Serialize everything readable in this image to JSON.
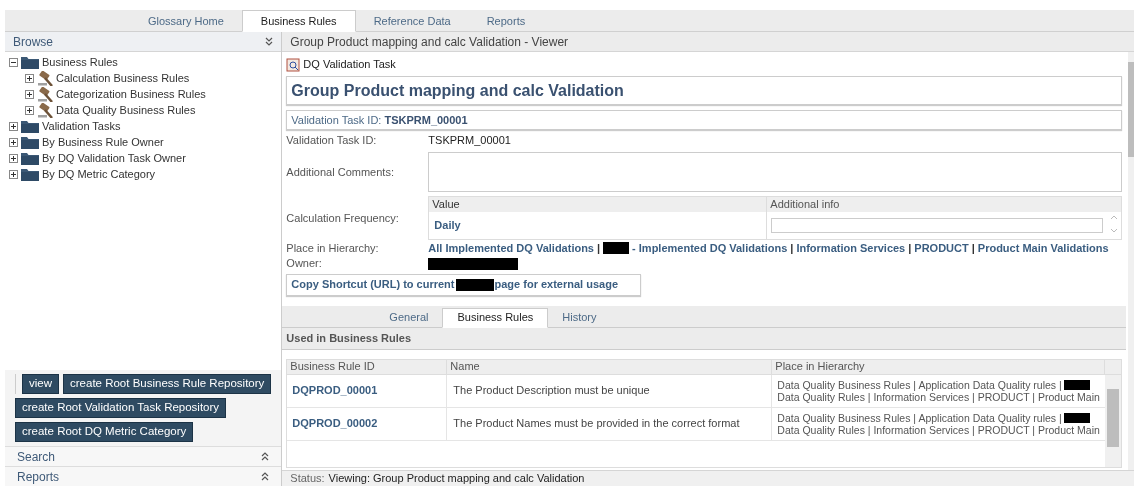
{
  "top_tabs": [
    {
      "label": "Glossary Home",
      "selected": false
    },
    {
      "label": "Business Rules",
      "selected": true
    },
    {
      "label": "Reference Data",
      "selected": false
    },
    {
      "label": "Reports",
      "selected": false
    }
  ],
  "browse": {
    "title": "Browse",
    "tree": [
      {
        "label": "Business Rules",
        "kind": "folder",
        "expanded": true,
        "children": [
          {
            "label": "Calculation Business Rules",
            "kind": "rule",
            "expanded": false
          },
          {
            "label": "Categorization Business Rules",
            "kind": "rule",
            "expanded": false
          },
          {
            "label": "Data Quality Business Rules",
            "kind": "rule",
            "expanded": false
          }
        ]
      },
      {
        "label": "Validation Tasks",
        "kind": "folder",
        "expanded": false
      },
      {
        "label": "By Business Rule Owner",
        "kind": "folder",
        "expanded": false
      },
      {
        "label": "By DQ Validation Task Owner",
        "kind": "folder",
        "expanded": false
      },
      {
        "label": "By DQ Metric Category",
        "kind": "folder",
        "expanded": false
      }
    ],
    "buttons": [
      [
        "view",
        "create Root Business Rule Repository"
      ],
      [
        "create Root Validation Task Repository"
      ],
      [
        "create Root DQ Metric Category"
      ]
    ]
  },
  "left_sections": [
    "Search",
    "Reports"
  ],
  "viewer": {
    "title": "Group Product mapping and calc Validation - Viewer",
    "type_label": "DQ Validation Task",
    "heading": "Group Product mapping and calc Validation",
    "id_banner": {
      "label": "Validation Task ID:",
      "value": "TSKPRM_00001"
    },
    "id_field": {
      "label": "Validation Task ID:",
      "value": "TSKPRM_00001"
    },
    "comments_label": "Additional Comments:",
    "frequency": {
      "label": "Calculation Frequency:",
      "columns": [
        "Value",
        "Additional info"
      ],
      "value": "Daily"
    },
    "hierarchy": {
      "label": "Place in Hierarchy:",
      "segments": [
        {
          "kind": "link",
          "text": "All Implemented DQ Validations"
        },
        {
          "kind": "sep",
          "text": "|"
        },
        {
          "kind": "redacted"
        },
        {
          "kind": "link",
          "text": "- Implemented DQ Validations"
        },
        {
          "kind": "sep",
          "text": "|"
        },
        {
          "kind": "link",
          "text": "Information Services"
        },
        {
          "kind": "sep",
          "text": "|"
        },
        {
          "kind": "link",
          "text": "PRODUCT"
        },
        {
          "kind": "sep",
          "text": "|"
        },
        {
          "kind": "link",
          "text": "Product Main Validations"
        }
      ]
    },
    "owner": {
      "label": "Owner:",
      "redacted": true
    },
    "shortcut": {
      "before": "Copy Shortcut (URL) to current",
      "after": "page for external usage"
    },
    "tabs": [
      {
        "label": "General",
        "selected": false
      },
      {
        "label": "Business Rules",
        "selected": true
      },
      {
        "label": "History",
        "selected": false
      }
    ],
    "section_title": "Used in Business Rules",
    "table": {
      "columns": [
        "Business Rule ID",
        "Name",
        "Place in Hierarchy"
      ],
      "rows": [
        {
          "id": "DQPROD_00001",
          "name": "The Product Description must be unique",
          "place_line1": "Data Quality Business Rules | Application Data Quality rules |",
          "place_line2": "Data Quality Rules | Information Services | PRODUCT | Product Main"
        },
        {
          "id": "DQPROD_00002",
          "name": "The Product Names must be provided in the correct format",
          "place_line1": "Data Quality Business Rules | Application Data Quality rules |",
          "place_line2": "Data Quality Rules | Information Services | PRODUCT | Product Main"
        }
      ]
    }
  },
  "status_bar": {
    "label": "Status:",
    "text": "Viewing: Group Product mapping and calc Validation"
  }
}
